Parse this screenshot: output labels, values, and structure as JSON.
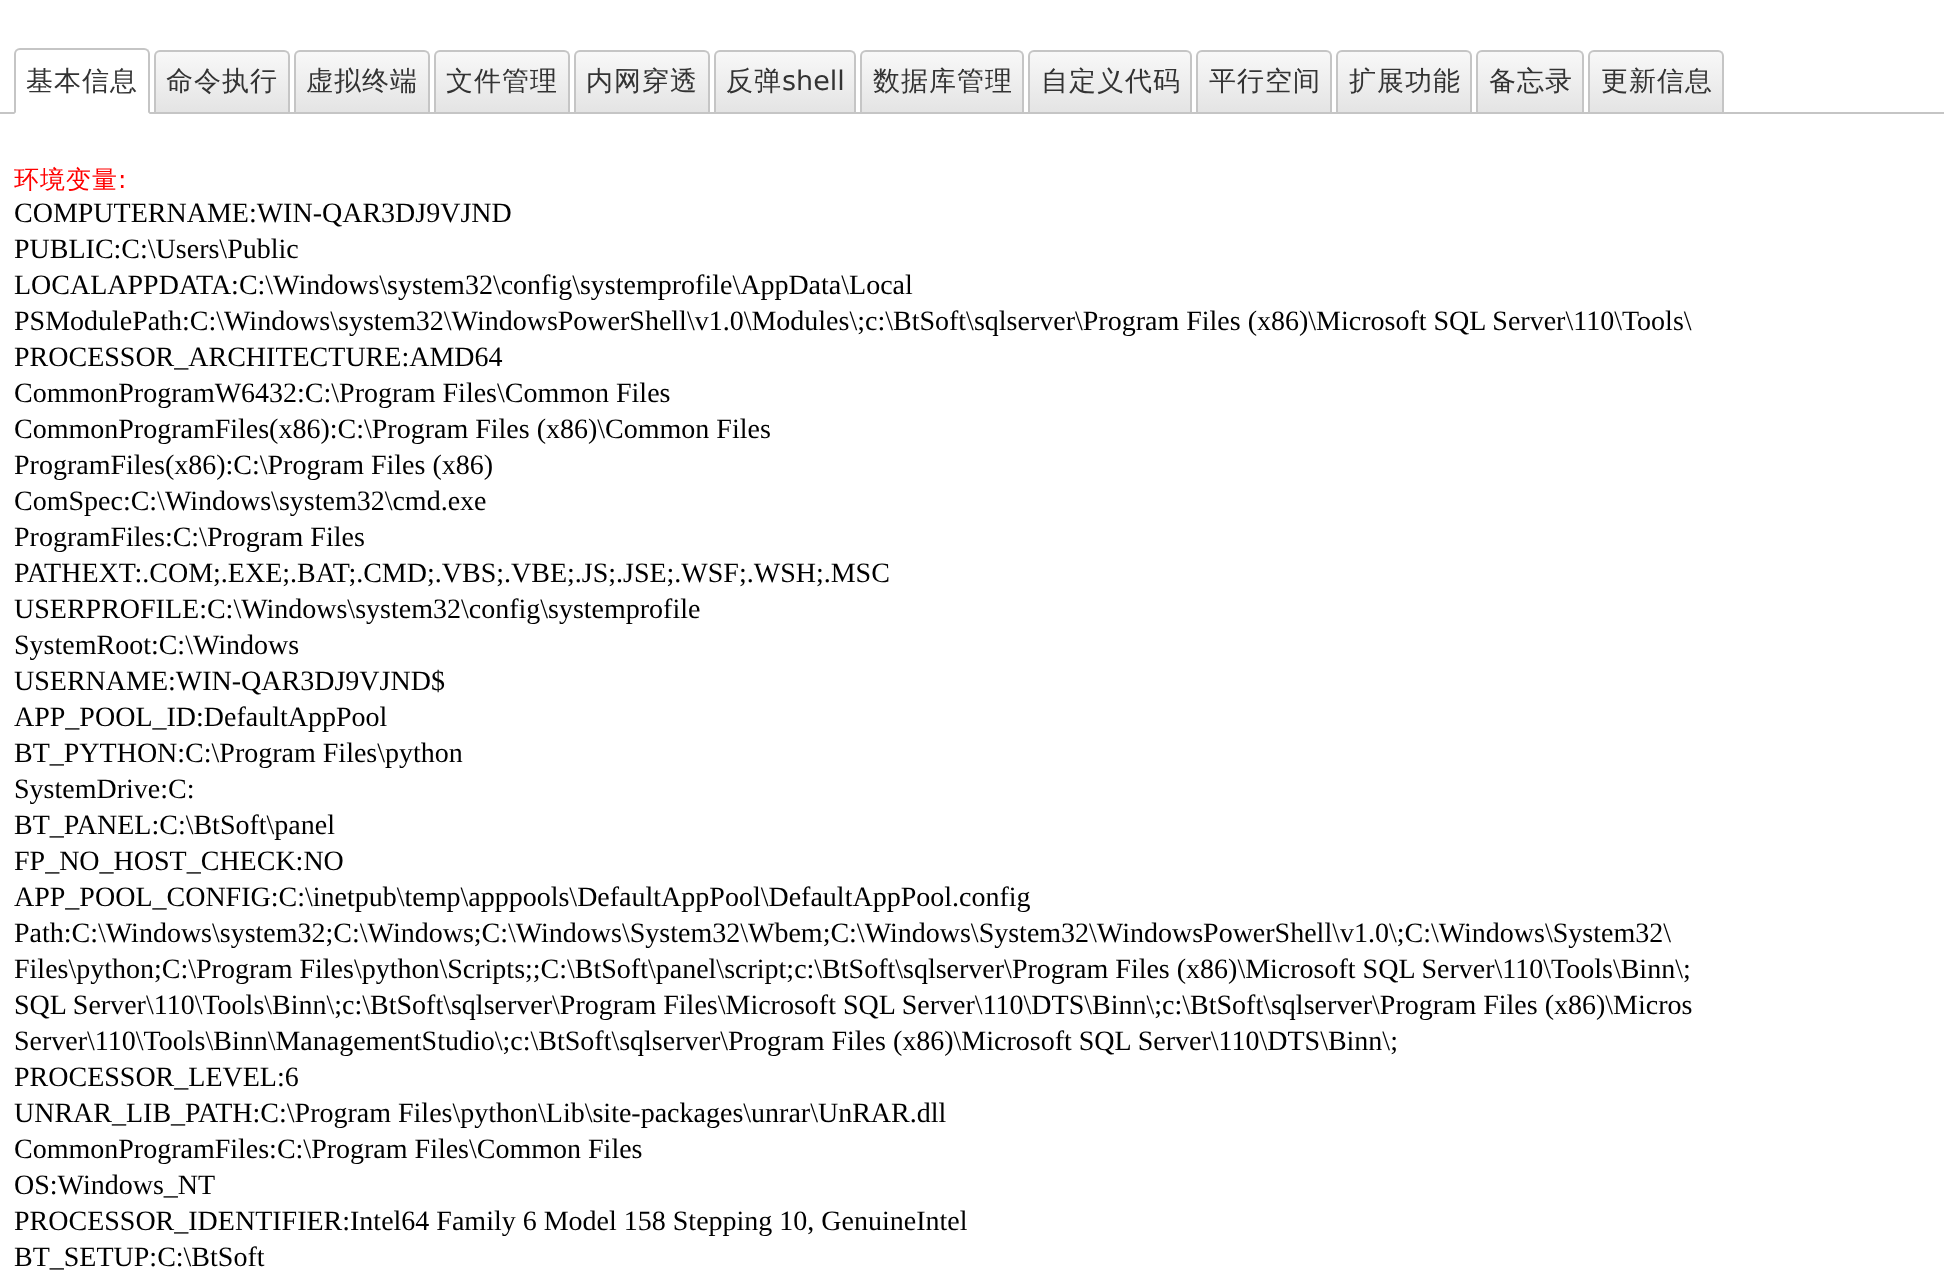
{
  "tabs": [
    {
      "label": "基本信息",
      "selected": true
    },
    {
      "label": "命令执行",
      "selected": false
    },
    {
      "label": "虚拟终端",
      "selected": false
    },
    {
      "label": "文件管理",
      "selected": false
    },
    {
      "label": "内网穿透",
      "selected": false
    },
    {
      "label": "反弹shell",
      "selected": false
    },
    {
      "label": "数据库管理",
      "selected": false
    },
    {
      "label": "自定义代码",
      "selected": false
    },
    {
      "label": "平行空间",
      "selected": false
    },
    {
      "label": "扩展功能",
      "selected": false
    },
    {
      "label": "备忘录",
      "selected": false
    },
    {
      "label": "更新信息",
      "selected": false
    }
  ],
  "section_title": "环境变量:",
  "lines": [
    "COMPUTERNAME:WIN-QAR3DJ9VJND",
    "PUBLIC:C:\\Users\\Public",
    "LOCALAPPDATA:C:\\Windows\\system32\\config\\systemprofile\\AppData\\Local",
    "PSModulePath:C:\\Windows\\system32\\WindowsPowerShell\\v1.0\\Modules\\;c:\\BtSoft\\sqlserver\\Program Files (x86)\\Microsoft SQL Server\\110\\Tools\\",
    "PROCESSOR_ARCHITECTURE:AMD64",
    "CommonProgramW6432:C:\\Program Files\\Common Files",
    "CommonProgramFiles(x86):C:\\Program Files (x86)\\Common Files",
    "ProgramFiles(x86):C:\\Program Files (x86)",
    "ComSpec:C:\\Windows\\system32\\cmd.exe",
    "ProgramFiles:C:\\Program Files",
    "PATHEXT:.COM;.EXE;.BAT;.CMD;.VBS;.VBE;.JS;.JSE;.WSF;.WSH;.MSC",
    "USERPROFILE:C:\\Windows\\system32\\config\\systemprofile",
    "SystemRoot:C:\\Windows",
    "USERNAME:WIN-QAR3DJ9VJND$",
    "APP_POOL_ID:DefaultAppPool",
    "BT_PYTHON:C:\\Program Files\\python",
    "SystemDrive:C:",
    "BT_PANEL:C:\\BtSoft\\panel",
    "FP_NO_HOST_CHECK:NO",
    "APP_POOL_CONFIG:C:\\inetpub\\temp\\apppools\\DefaultAppPool\\DefaultAppPool.config",
    "Path:C:\\Windows\\system32;C:\\Windows;C:\\Windows\\System32\\Wbem;C:\\Windows\\System32\\WindowsPowerShell\\v1.0\\;C:\\Windows\\System32\\",
    "Files\\python;C:\\Program Files\\python\\Scripts;;C:\\BtSoft\\panel\\script;c:\\BtSoft\\sqlserver\\Program Files (x86)\\Microsoft SQL Server\\110\\Tools\\Binn\\;",
    "SQL Server\\110\\Tools\\Binn\\;c:\\BtSoft\\sqlserver\\Program Files\\Microsoft SQL Server\\110\\DTS\\Binn\\;c:\\BtSoft\\sqlserver\\Program Files (x86)\\Micros",
    "Server\\110\\Tools\\Binn\\ManagementStudio\\;c:\\BtSoft\\sqlserver\\Program Files (x86)\\Microsoft SQL Server\\110\\DTS\\Binn\\;",
    "PROCESSOR_LEVEL:6",
    "UNRAR_LIB_PATH:C:\\Program Files\\python\\Lib\\site-packages\\unrar\\UnRAR.dll",
    "CommonProgramFiles:C:\\Program Files\\Common Files",
    "OS:Windows_NT",
    "PROCESSOR_IDENTIFIER:Intel64 Family 6 Model 158 Stepping 10, GenuineIntel",
    "BT_SETUP:C:\\BtSoft"
  ]
}
